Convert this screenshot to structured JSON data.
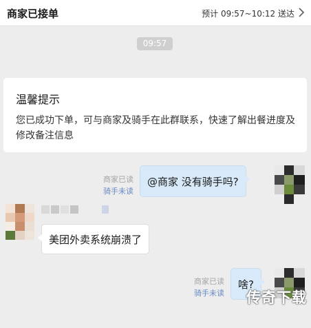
{
  "header": {
    "title": "商家已接单",
    "eta": "预计 09:57~10:12 送达"
  },
  "timestamp": "09:57",
  "notice": {
    "title": "温馨提示",
    "body": "您已成功下单，可与商家及骑手在此群联系，快速了解出餐进度及修改备注信息"
  },
  "messages": [
    {
      "direction": "out",
      "text": "@商家 没有骑手吗?",
      "receipt_merchant": "商家已读",
      "receipt_rider": "骑手未读"
    },
    {
      "direction": "in",
      "text": "美团外卖系统崩溃了"
    },
    {
      "direction": "out",
      "text": "啥?",
      "receipt_merchant": "商家已读",
      "receipt_rider": "骑手未读"
    }
  ],
  "watermark": "传奇下载",
  "colors": {
    "background": "#ededed",
    "outgoing_bubble": "#d8eaf9",
    "incoming_bubble": "#ffffff",
    "rider_unread": "#6a8bc5"
  }
}
